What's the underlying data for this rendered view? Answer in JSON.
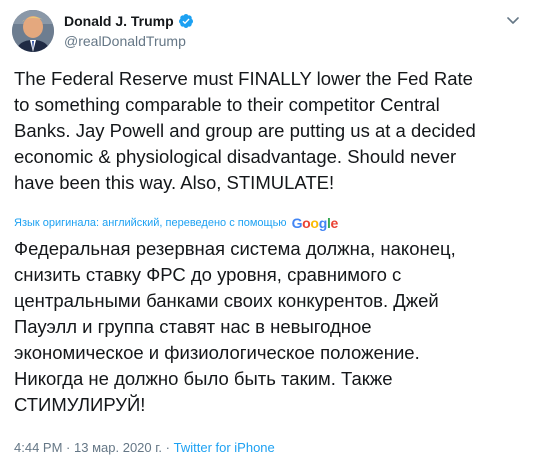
{
  "author": {
    "display_name": "Donald J. Trump",
    "handle": "@realDonaldTrump",
    "verified": true
  },
  "tweet": {
    "text": "The Federal Reserve must FINALLY lower the Fed Rate\nto something comparable to their competitor Central\nBanks. Jay Powell and group are putting us at a decided\neconomic & physiological disadvantage. Should never\nhave been this way. Also, STIMULATE!",
    "translation_note": "Язык оригинала: английский, переведено с помощью",
    "translation_provider": "Google",
    "translated_text": "Федеральная резервная система должна, наконец,\nснизить ставку ФРС до уровня, сравнимого с\nцентральными банками своих конкурентов. Джей\nПауэлл и группа ставят нас в невыгодное\nэкономическое и физиологическое положение.\nНикогда не должно было быть таким. Также\nСТИМУЛИРУЙ!",
    "time": "4:44 PM",
    "date": "13 мар. 2020 г.",
    "separator": "·",
    "source": "Twitter for iPhone"
  },
  "icons": {
    "verified": "verified-badge-icon",
    "caret": "chevron-down-icon"
  },
  "colors": {
    "accent": "#1da1f2",
    "text": "#14171a",
    "muted": "#657786"
  }
}
